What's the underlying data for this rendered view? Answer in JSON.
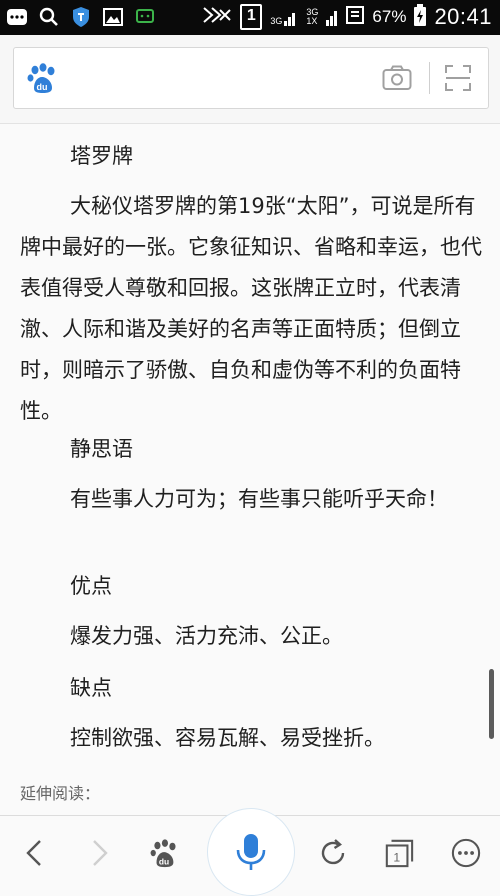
{
  "status_bar": {
    "icons_left": [
      "mail-icon",
      "search-icon",
      "shield-icon",
      "image-icon",
      "wechat-icon"
    ],
    "sim_label": "1",
    "network_3g_a": "3G",
    "network_3g_b": "3G",
    "network_1x": "1X",
    "battery_percent": "67%",
    "time": "20:41"
  },
  "search_bar": {
    "logo": "baidu-paw-icon",
    "camera": "camera-icon",
    "scan": "scan-icon"
  },
  "article": {
    "heading1": "塔罗牌",
    "para1": "大秘仪塔罗牌的第19张“太阳”，可说是所有牌中最好的一张。它象征知识、省略和幸运，也代表值得受人尊敬和回报。这张牌正立时，代表清澈、人际和谐及美好的名声等正面特质；但倒立时，则暗示了骄傲、自负和虚伪等不利的负面特性。",
    "heading2": "静思语",
    "para2": "有些事人力可为；有些事只能听乎天命！",
    "heading3": "优点",
    "para3": "爆发力强、活力充沛、公正。",
    "heading4": "缺点",
    "para4": "控制欲强、容易瓦解、易受挫折。",
    "more_label": "延伸阅读："
  },
  "bottom_bar": {
    "tabs_count": "1"
  },
  "colors": {
    "accent_blue": "#2f7fd8",
    "text": "#1f1f1f",
    "icon_gray": "#666666"
  }
}
